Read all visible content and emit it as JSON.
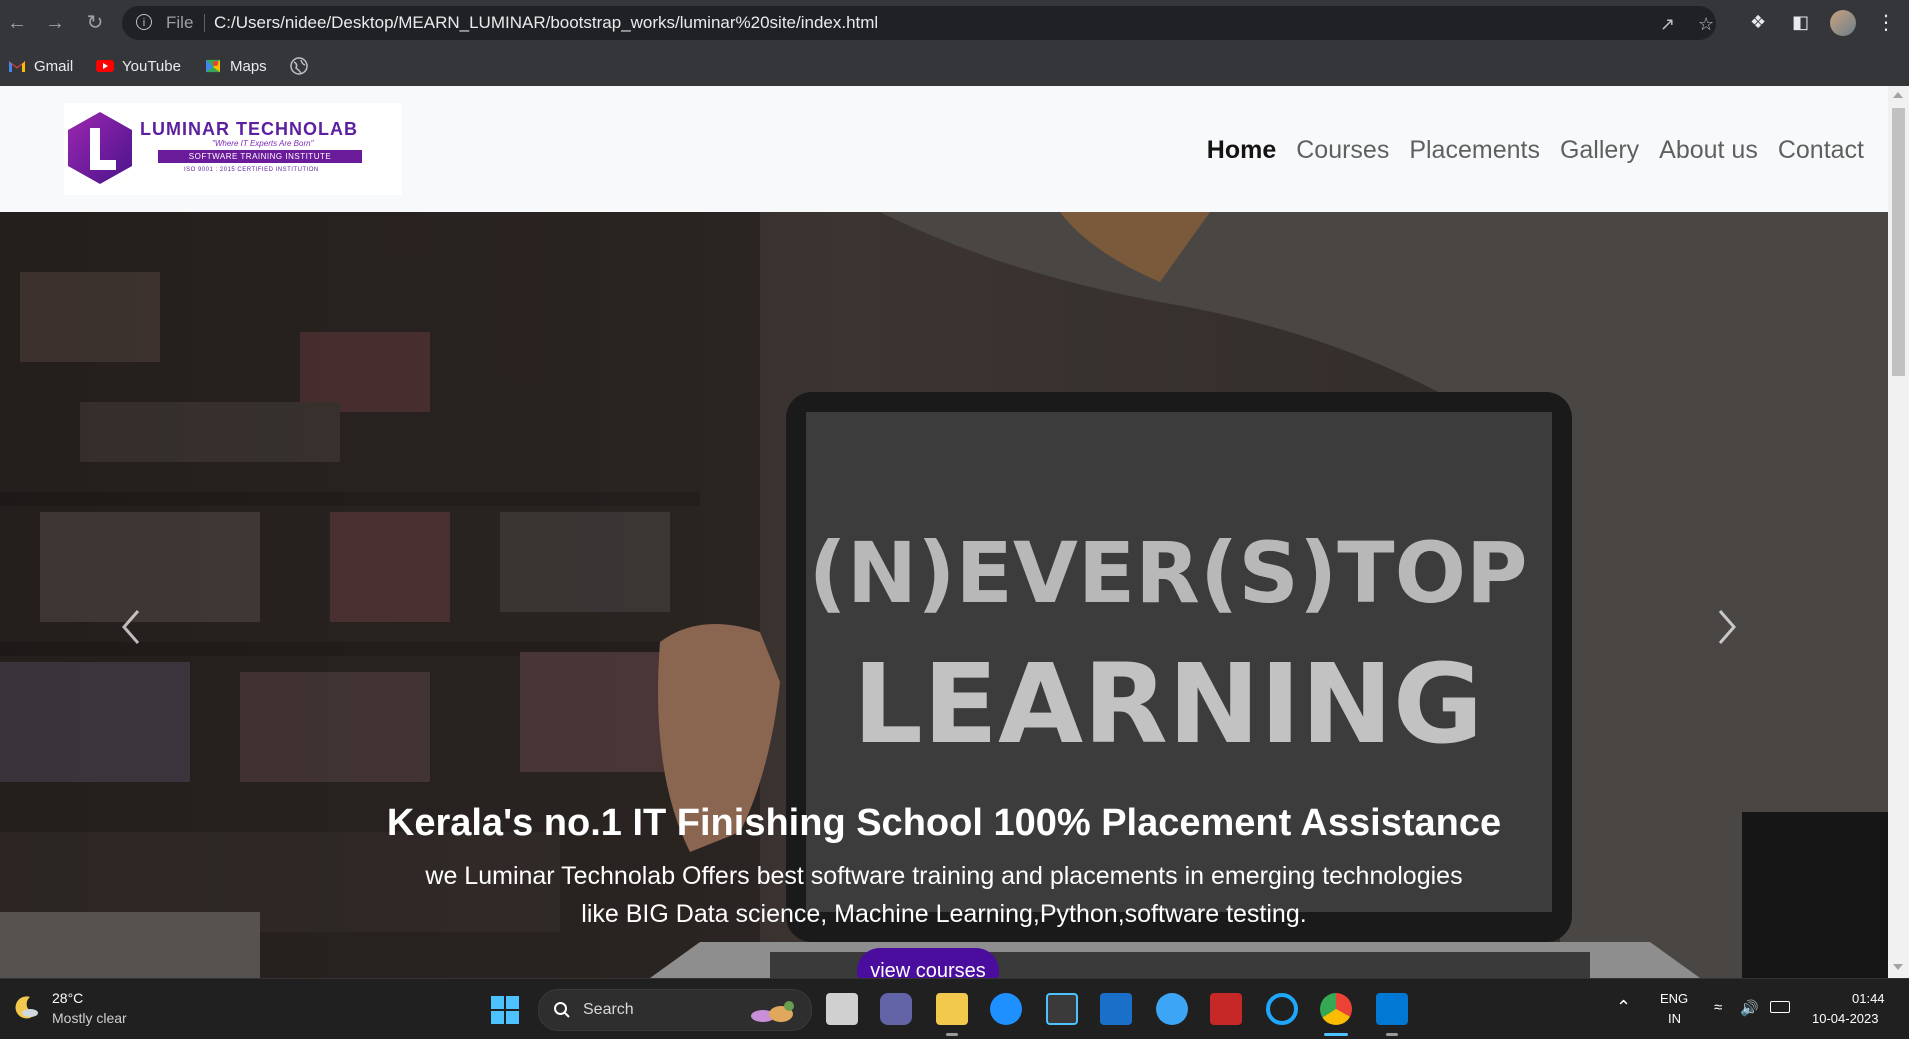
{
  "browser": {
    "scheme": "File",
    "url": "C:/Users/nidee/Desktop/MEARN_LUMINAR/bootstrap_works/luminar%20site/index.html",
    "bookmarks": [
      {
        "label": "Gmail",
        "icon": "gmail-icon"
      },
      {
        "label": "YouTube",
        "icon": "youtube-icon"
      },
      {
        "label": "Maps",
        "icon": "maps-icon"
      }
    ]
  },
  "site": {
    "logo": {
      "title": "LUMINAR TECHNOLAB",
      "tagline": "\"Where IT Experts Are Born\"",
      "bar": "SOFTWARE TRAINING INSTITUTE",
      "iso": "ISO 9001 : 2015 CERTIFIED INSTITUTION"
    },
    "nav": [
      {
        "label": "Home",
        "active": true
      },
      {
        "label": "Courses",
        "active": false
      },
      {
        "label": "Placements",
        "active": false
      },
      {
        "label": "Gallery",
        "active": false
      },
      {
        "label": "About us",
        "active": false
      },
      {
        "label": "Contact",
        "active": false
      }
    ],
    "hero": {
      "image_text_1": "(N)EVER(S)TOP",
      "image_text_2": "LEARNING",
      "title": "Kerala's no.1 IT Finishing School 100% Placement Assistance",
      "line1": "we Luminar Technolab Offers best software training and placements in emerging technologies",
      "line2": "like BIG Data science, Machine Learning,Python,software testing.",
      "button": "view courses"
    },
    "colors": {
      "brand": "#5b1fa0",
      "button": "#4a0d9e"
    }
  },
  "taskbar": {
    "weather": {
      "temp": "28°C",
      "desc": "Mostly clear"
    },
    "search_label": "Search",
    "lang": "ENG",
    "region": "IN",
    "time": "01:44",
    "date": "10-04-2023"
  }
}
